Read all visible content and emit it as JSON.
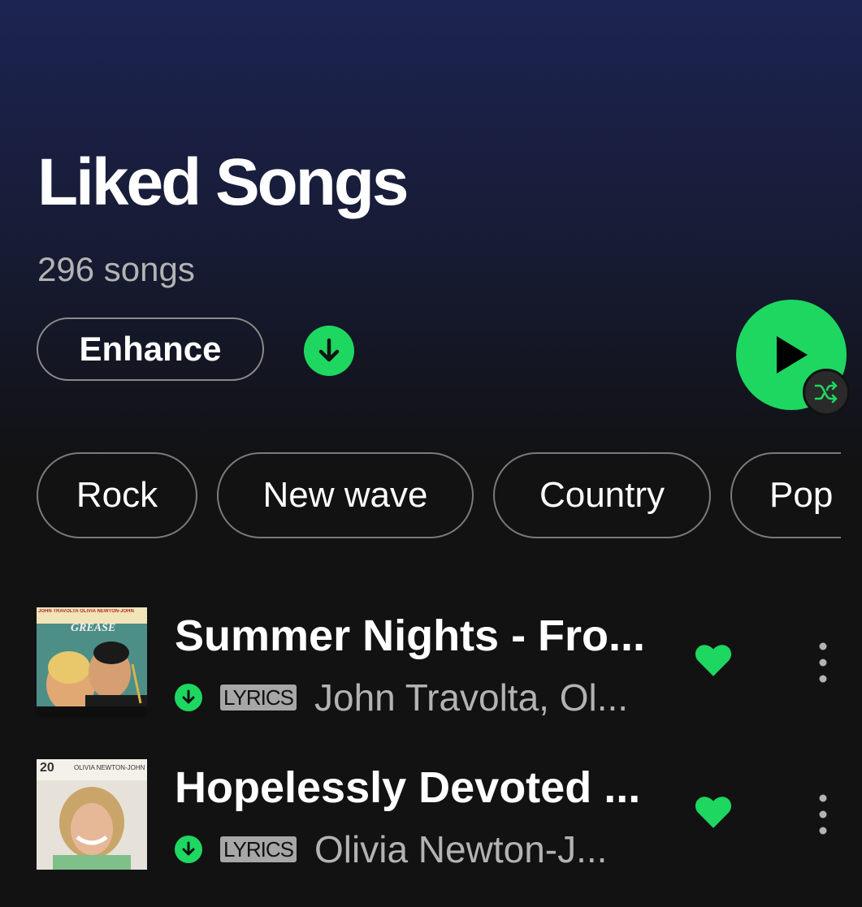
{
  "header": {
    "title": "Liked Songs",
    "song_count": "296 songs",
    "enhance_label": "Enhance"
  },
  "controls": {
    "download_icon": "download-icon",
    "play_icon": "play-icon",
    "shuffle_icon": "shuffle-icon"
  },
  "chips": [
    {
      "label": "Rock"
    },
    {
      "label": "New wave"
    },
    {
      "label": "Country"
    },
    {
      "label": "Pop"
    }
  ],
  "tracks": [
    {
      "title": "Summer Nights - Fro...",
      "badge": "LYRICS",
      "artist": "John Travolta, Ol...",
      "art_text_top": "JOHN TRAVOLTA   OLIVIA NEWTON-JOHN",
      "art_logo": "GREASE",
      "liked": true,
      "downloaded": true
    },
    {
      "title": "Hopelessly Devoted ...",
      "badge": "LYRICS",
      "artist": "Olivia Newton-J...",
      "art_text_top": "OLIVIA NEWTON-JOHN",
      "art_logo": "20",
      "liked": true,
      "downloaded": true
    }
  ],
  "colors": {
    "accent": "#1ed760",
    "background": "#121212",
    "header_gradient_top": "#1c2452",
    "secondary_text": "#b3b3b3"
  }
}
